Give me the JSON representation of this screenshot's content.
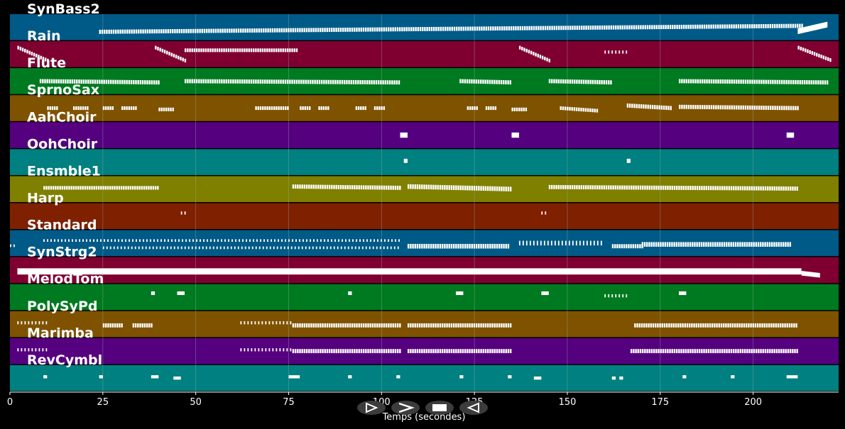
{
  "chart_data": {
    "type": "piano-roll",
    "xlabel": "Temps (secondes)",
    "xlim": [
      0,
      223
    ],
    "xticks": [
      0,
      25,
      50,
      75,
      100,
      125,
      150,
      175,
      200
    ],
    "grid": true,
    "tracks": [
      {
        "name": "SynBass2",
        "color": "#005a87",
        "notes": [
          [
            24,
            213,
            0.68,
            0.45,
            0.16,
            "dense"
          ],
          [
            212,
            220,
            0.66,
            0.4,
            0.22,
            "solid"
          ]
        ]
      },
      {
        "name": "Rain",
        "color": "#7f0030",
        "notes": [
          [
            2,
            10,
            0.25,
            0.75,
            0.14,
            "dense"
          ],
          [
            39,
            47,
            0.25,
            0.75,
            0.14,
            "dense"
          ],
          [
            47,
            77,
            0.35,
            0.35,
            0.14,
            "dense"
          ],
          [
            137,
            145,
            0.25,
            0.75,
            0.14,
            "dense"
          ],
          [
            160,
            166,
            0.42,
            0.42,
            0.12,
            "sparse"
          ],
          [
            212,
            221,
            0.25,
            0.75,
            0.14,
            "dense"
          ]
        ]
      },
      {
        "name": "Flute",
        "color": "#007a20",
        "notes": [
          [
            8,
            40,
            0.5,
            0.55,
            0.16,
            "dense"
          ],
          [
            47,
            105,
            0.5,
            0.55,
            0.16,
            "dense"
          ],
          [
            121,
            135,
            0.5,
            0.55,
            0.16,
            "dense"
          ],
          [
            145,
            162,
            0.5,
            0.55,
            0.16,
            "dense"
          ],
          [
            180,
            220,
            0.5,
            0.55,
            0.16,
            "dense"
          ]
        ]
      },
      {
        "name": "SprnoSax",
        "color": "#7f5200",
        "notes": [
          [
            10,
            13,
            0.5,
            0.5,
            0.14,
            "dense"
          ],
          [
            17,
            21,
            0.5,
            0.5,
            0.14,
            "dense"
          ],
          [
            25,
            28,
            0.5,
            0.5,
            0.14,
            "dense"
          ],
          [
            30,
            34,
            0.5,
            0.5,
            0.14,
            "dense"
          ],
          [
            40,
            44,
            0.55,
            0.55,
            0.14,
            "dense"
          ],
          [
            66,
            75,
            0.5,
            0.5,
            0.14,
            "dense"
          ],
          [
            78,
            81,
            0.5,
            0.5,
            0.14,
            "dense"
          ],
          [
            83,
            86,
            0.5,
            0.5,
            0.14,
            "dense"
          ],
          [
            93,
            96,
            0.5,
            0.5,
            0.14,
            "dense"
          ],
          [
            98,
            101,
            0.5,
            0.5,
            0.14,
            "dense"
          ],
          [
            123,
            126,
            0.5,
            0.5,
            0.14,
            "dense"
          ],
          [
            128,
            131,
            0.5,
            0.5,
            0.14,
            "dense"
          ],
          [
            135,
            139,
            0.55,
            0.55,
            0.14,
            "dense"
          ],
          [
            148,
            158,
            0.5,
            0.6,
            0.14,
            "dense"
          ],
          [
            166,
            178,
            0.4,
            0.5,
            0.16,
            "dense"
          ],
          [
            180,
            212,
            0.45,
            0.5,
            0.16,
            "dense"
          ]
        ]
      },
      {
        "name": "AahChoir",
        "color": "#55007f",
        "notes": [
          [
            105,
            107,
            0.5,
            0.5,
            0.2,
            "solid"
          ],
          [
            135,
            137,
            0.5,
            0.5,
            0.2,
            "solid"
          ],
          [
            209,
            211,
            0.5,
            0.5,
            0.2,
            "solid"
          ]
        ]
      },
      {
        "name": "OohChoir",
        "color": "#008080",
        "notes": [
          [
            106,
            107,
            0.45,
            0.45,
            0.16,
            "solid"
          ],
          [
            166,
            167,
            0.45,
            0.45,
            0.16,
            "solid"
          ]
        ]
      },
      {
        "name": "Ensmble1",
        "color": "#7f7f00",
        "notes": [
          [
            9,
            40,
            0.45,
            0.45,
            0.14,
            "dense"
          ],
          [
            76,
            105,
            0.4,
            0.45,
            0.16,
            "dense"
          ],
          [
            107,
            135,
            0.4,
            0.5,
            0.18,
            "dense"
          ],
          [
            145,
            212,
            0.42,
            0.48,
            0.16,
            "dense"
          ]
        ]
      },
      {
        "name": "Harp",
        "color": "#7f2000",
        "notes": [
          [
            46,
            47,
            0.38,
            0.38,
            0.12,
            "sparse"
          ],
          [
            143,
            144,
            0.38,
            0.38,
            0.12,
            "sparse"
          ]
        ]
      },
      {
        "name": "Standard",
        "color": "#005a87",
        "notes": [
          [
            0,
            1,
            0.6,
            0.6,
            0.1,
            "sparse"
          ],
          [
            9,
            105,
            0.4,
            0.4,
            0.1,
            "sparse"
          ],
          [
            25,
            105,
            0.68,
            0.68,
            0.1,
            "sparse"
          ],
          [
            107,
            134,
            0.62,
            0.62,
            0.18,
            "dense"
          ],
          [
            137,
            159,
            0.5,
            0.5,
            0.18,
            "sparse"
          ],
          [
            162,
            170,
            0.62,
            0.62,
            0.16,
            "dense"
          ],
          [
            170,
            210,
            0.55,
            0.55,
            0.18,
            "dense"
          ]
        ]
      },
      {
        "name": "SynStrg2",
        "color": "#7f0030",
        "notes": [
          [
            2,
            213,
            0.55,
            0.55,
            0.24,
            "solid"
          ],
          [
            213,
            218,
            0.62,
            0.7,
            0.18,
            "solid"
          ]
        ]
      },
      {
        "name": "MelodTom",
        "color": "#007a20",
        "notes": [
          [
            38,
            39,
            0.35,
            0.35,
            0.14,
            "solid"
          ],
          [
            45,
            47,
            0.35,
            0.35,
            0.14,
            "solid"
          ],
          [
            91,
            92,
            0.35,
            0.35,
            0.14,
            "solid"
          ],
          [
            120,
            122,
            0.35,
            0.35,
            0.14,
            "solid"
          ],
          [
            143,
            145,
            0.35,
            0.35,
            0.14,
            "solid"
          ],
          [
            160,
            166,
            0.45,
            0.45,
            0.12,
            "sparse"
          ],
          [
            180,
            182,
            0.35,
            0.35,
            0.14,
            "solid"
          ]
        ]
      },
      {
        "name": "PolySyPd",
        "color": "#7f5200",
        "notes": [
          [
            2,
            10,
            0.45,
            0.45,
            0.12,
            "sparse"
          ],
          [
            25,
            30,
            0.55,
            0.55,
            0.16,
            "dense"
          ],
          [
            33,
            38,
            0.55,
            0.55,
            0.16,
            "dense"
          ],
          [
            62,
            76,
            0.45,
            0.45,
            0.12,
            "sparse"
          ],
          [
            76,
            105,
            0.55,
            0.55,
            0.16,
            "dense"
          ],
          [
            107,
            135,
            0.55,
            0.55,
            0.16,
            "dense"
          ],
          [
            168,
            212,
            0.55,
            0.55,
            0.16,
            "dense"
          ]
        ]
      },
      {
        "name": "Marimba",
        "color": "#55007f",
        "notes": [
          [
            2,
            10,
            0.45,
            0.45,
            0.12,
            "sparse"
          ],
          [
            62,
            76,
            0.45,
            0.45,
            0.12,
            "sparse"
          ],
          [
            76,
            105,
            0.5,
            0.5,
            0.16,
            "dense"
          ],
          [
            107,
            135,
            0.5,
            0.5,
            0.16,
            "dense"
          ],
          [
            167,
            212,
            0.5,
            0.5,
            0.16,
            "dense"
          ]
        ]
      },
      {
        "name": "RevCymbl",
        "color": "#008080",
        "notes": [
          [
            9,
            10,
            0.45,
            0.45,
            0.12,
            "solid"
          ],
          [
            24,
            25,
            0.45,
            0.45,
            0.12,
            "solid"
          ],
          [
            38,
            40,
            0.45,
            0.45,
            0.12,
            "solid"
          ],
          [
            44,
            46,
            0.5,
            0.5,
            0.12,
            "solid"
          ],
          [
            75,
            78,
            0.45,
            0.45,
            0.12,
            "solid"
          ],
          [
            91,
            92,
            0.45,
            0.45,
            0.12,
            "solid"
          ],
          [
            104,
            105,
            0.45,
            0.45,
            0.12,
            "solid"
          ],
          [
            121,
            122,
            0.45,
            0.45,
            0.12,
            "solid"
          ],
          [
            134,
            135,
            0.45,
            0.45,
            0.12,
            "solid"
          ],
          [
            141,
            143,
            0.5,
            0.5,
            0.12,
            "solid"
          ],
          [
            162,
            163,
            0.5,
            0.5,
            0.12,
            "solid"
          ],
          [
            164,
            165,
            0.5,
            0.5,
            0.12,
            "solid"
          ],
          [
            181,
            182,
            0.45,
            0.45,
            0.12,
            "solid"
          ],
          [
            194,
            195,
            0.45,
            0.45,
            0.12,
            "solid"
          ],
          [
            209,
            212,
            0.45,
            0.45,
            0.12,
            "solid"
          ]
        ]
      }
    ]
  },
  "controls": [
    {
      "id": "play",
      "icon": "play-outline-icon"
    },
    {
      "id": "forward",
      "icon": "chevron-right-icon"
    },
    {
      "id": "stop",
      "icon": "stop-icon"
    },
    {
      "id": "back",
      "icon": "back-triangle-icon"
    }
  ],
  "colors": {
    "background": "#000000",
    "separator": "#1a1a1a",
    "grid": "#9ab0b0",
    "note": "#ffffff",
    "control_bg": "#3c3c3c"
  }
}
